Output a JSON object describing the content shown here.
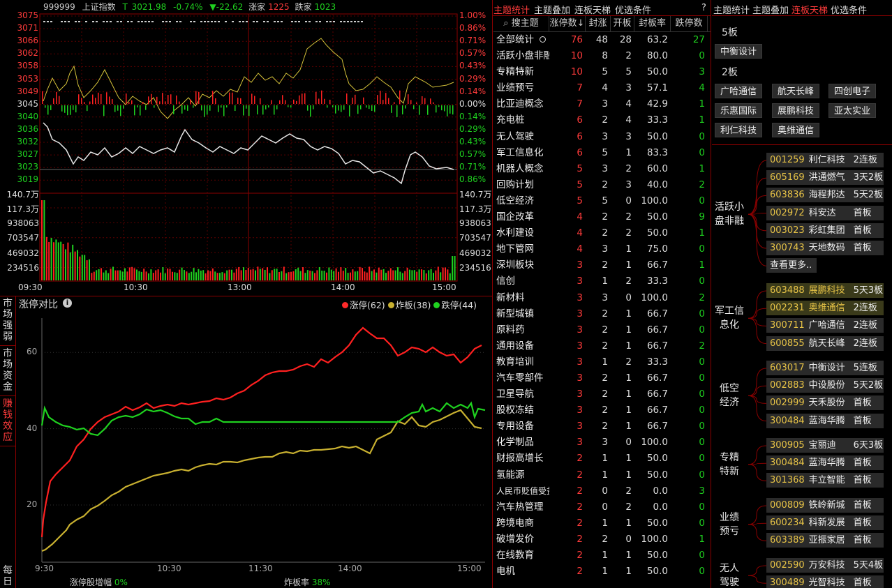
{
  "index_header": {
    "code": "999999",
    "name": "上证指数",
    "t_label": "T",
    "price": "3021.98",
    "pct": "-0.74%",
    "chg": "▼-22.62",
    "up_label": "涨家",
    "up_count": "1225",
    "down_label": "跌家",
    "down_count": "1023"
  },
  "price_axis_left": [
    "3075",
    "3071",
    "3066",
    "3062",
    "3058",
    "3053",
    "3049",
    "3045",
    "3040",
    "3036",
    "3032",
    "3027",
    "3023",
    "3019"
  ],
  "price_axis_right": [
    "1.00%",
    "0.86%",
    "0.71%",
    "0.57%",
    "0.43%",
    "0.29%",
    "0.14%",
    "0.00%",
    "0.14%",
    "0.29%",
    "0.43%",
    "0.57%",
    "0.71%",
    "0.86%"
  ],
  "vol_axis": [
    "140.7万",
    "117.3万",
    "938063",
    "703547",
    "469032",
    "234516"
  ],
  "time_axis": [
    "09:30",
    "10:30",
    "13:00",
    "14:00",
    "15:00"
  ],
  "limit_panel": {
    "title": "涨停对比",
    "legend": [
      {
        "label": "涨停(62)",
        "color": "#ff2a2a"
      },
      {
        "label": "炸板(38)",
        "color": "#c8b030"
      },
      {
        "label": "跌停(44)",
        "color": "#1fd11f"
      }
    ],
    "y_ticks": [
      "60",
      "40",
      "20"
    ],
    "x_ticks": [
      "9:30",
      "10:30",
      "11:30",
      "14:00",
      "15:00"
    ],
    "footer_left_label": "涨停股增幅",
    "footer_left_value": "0%",
    "footer_right_label": "炸板率",
    "footer_right_value": "38%"
  },
  "side_tabs": [
    "市场强弱",
    "市场资金",
    "赚钱效应",
    "每日"
  ],
  "mid_tabs": [
    "主题统计",
    "主题叠加",
    "连板天梯",
    "优选条件",
    "?"
  ],
  "table": {
    "headers": [
      "搜主题",
      "涨停数",
      "封涨",
      "开板",
      "封板率",
      "跌停数"
    ],
    "rows": [
      [
        "全部统计",
        "76",
        "48",
        "28",
        "63.2",
        "27"
      ],
      [
        "活跃小盘非融",
        "10",
        "8",
        "2",
        "80.0",
        "0"
      ],
      [
        "专精特新",
        "10",
        "5",
        "5",
        "50.0",
        "3"
      ],
      [
        "业绩预亏",
        "7",
        "4",
        "3",
        "57.1",
        "4"
      ],
      [
        "比亚迪概念",
        "7",
        "3",
        "4",
        "42.9",
        "1"
      ],
      [
        "充电桩",
        "6",
        "2",
        "4",
        "33.3",
        "1"
      ],
      [
        "无人驾驶",
        "6",
        "3",
        "3",
        "50.0",
        "0"
      ],
      [
        "军工信息化",
        "6",
        "5",
        "1",
        "83.3",
        "0"
      ],
      [
        "机器人概念",
        "5",
        "3",
        "2",
        "60.0",
        "1"
      ],
      [
        "回购计划",
        "5",
        "2",
        "3",
        "40.0",
        "2"
      ],
      [
        "低空经济",
        "5",
        "5",
        "0",
        "100.0",
        "0"
      ],
      [
        "国企改革",
        "4",
        "2",
        "2",
        "50.0",
        "9"
      ],
      [
        "水利建设",
        "4",
        "2",
        "2",
        "50.0",
        "1"
      ],
      [
        "地下管网",
        "4",
        "3",
        "1",
        "75.0",
        "0"
      ],
      [
        "深圳板块",
        "3",
        "2",
        "1",
        "66.7",
        "1"
      ],
      [
        "信创",
        "3",
        "1",
        "2",
        "33.3",
        "0"
      ],
      [
        "新材料",
        "3",
        "3",
        "0",
        "100.0",
        "2"
      ],
      [
        "新型城镇",
        "3",
        "2",
        "1",
        "66.7",
        "0"
      ],
      [
        "原料药",
        "3",
        "2",
        "1",
        "66.7",
        "0"
      ],
      [
        "通用设备",
        "3",
        "2",
        "1",
        "66.7",
        "2"
      ],
      [
        "教育培训",
        "3",
        "1",
        "2",
        "33.3",
        "0"
      ],
      [
        "汽车零部件",
        "3",
        "2",
        "1",
        "66.7",
        "0"
      ],
      [
        "卫星导航",
        "3",
        "2",
        "1",
        "66.7",
        "0"
      ],
      [
        "股权冻结",
        "3",
        "2",
        "1",
        "66.7",
        "0"
      ],
      [
        "专用设备",
        "3",
        "2",
        "1",
        "66.7",
        "0"
      ],
      [
        "化学制品",
        "3",
        "3",
        "0",
        "100.0",
        "0"
      ],
      [
        "财报高增长",
        "2",
        "1",
        "1",
        "50.0",
        "0"
      ],
      [
        "氢能源",
        "2",
        "1",
        "1",
        "50.0",
        "0"
      ],
      [
        "人民币贬值受益",
        "2",
        "0",
        "2",
        "0.0",
        "3"
      ],
      [
        "汽车热管理",
        "2",
        "0",
        "2",
        "0.0",
        "0"
      ],
      [
        "跨境电商",
        "2",
        "1",
        "1",
        "50.0",
        "0"
      ],
      [
        "破增发价",
        "2",
        "2",
        "0",
        "100.0",
        "1"
      ],
      [
        "在线教育",
        "2",
        "1",
        "1",
        "50.0",
        "0"
      ],
      [
        "电机",
        "2",
        "1",
        "1",
        "50.0",
        "0"
      ]
    ]
  },
  "right_tabs": [
    "主题统计",
    "主题叠加",
    "连板天梯",
    "优选条件"
  ],
  "ladder": {
    "l5": "5板",
    "l5_stocks": [
      "中衡设计"
    ],
    "l2": "2板",
    "l2_stocks": [
      "广哈通信",
      "航天长峰",
      "四创电子",
      "乐惠国际",
      "展鹏科技",
      "亚太实业",
      "利仁科技",
      "奥维通信"
    ]
  },
  "groups": [
    {
      "name": "活跃小盘非融",
      "items": [
        [
          "001259",
          "利仁科技",
          "2连板"
        ],
        [
          "605169",
          "洪通燃气",
          "3天2板"
        ],
        [
          "603836",
          "海程邦达",
          "5天2板"
        ],
        [
          "002972",
          "科安达",
          "首板"
        ],
        [
          "003023",
          "彩虹集团",
          "首板"
        ],
        [
          "300743",
          "天地数码",
          "首板"
        ]
      ],
      "more": "查看更多.."
    },
    {
      "name": "军工信息化",
      "items": [
        [
          "603488",
          "展鹏科技",
          "5天3板"
        ],
        [
          "002231",
          "奥维通信",
          "2连板"
        ],
        [
          "300711",
          "广哈通信",
          "2连板"
        ],
        [
          "600855",
          "航天长峰",
          "2连板"
        ]
      ]
    },
    {
      "name": "低空经济",
      "items": [
        [
          "603017",
          "中衡设计",
          "5连板"
        ],
        [
          "002883",
          "中设股份",
          "5天2板"
        ],
        [
          "002999",
          "天禾股份",
          "首板"
        ],
        [
          "300484",
          "蓝海华腾",
          "首板"
        ]
      ]
    },
    {
      "name": "专精特新",
      "items": [
        [
          "300905",
          "宝丽迪",
          "6天3板"
        ],
        [
          "300484",
          "蓝海华腾",
          "首板"
        ],
        [
          "301368",
          "丰立智能",
          "首板"
        ]
      ]
    },
    {
      "name": "业绩预亏",
      "items": [
        [
          "000809",
          "铁岭新城",
          "首板"
        ],
        [
          "600234",
          "科新发展",
          "首板"
        ],
        [
          "603389",
          "亚振家居",
          "首板"
        ]
      ]
    },
    {
      "name": "无人驾驶",
      "items": [
        [
          "002590",
          "万安科技",
          "5天4板"
        ],
        [
          "300489",
          "光智科技",
          "首板"
        ]
      ]
    }
  ]
}
